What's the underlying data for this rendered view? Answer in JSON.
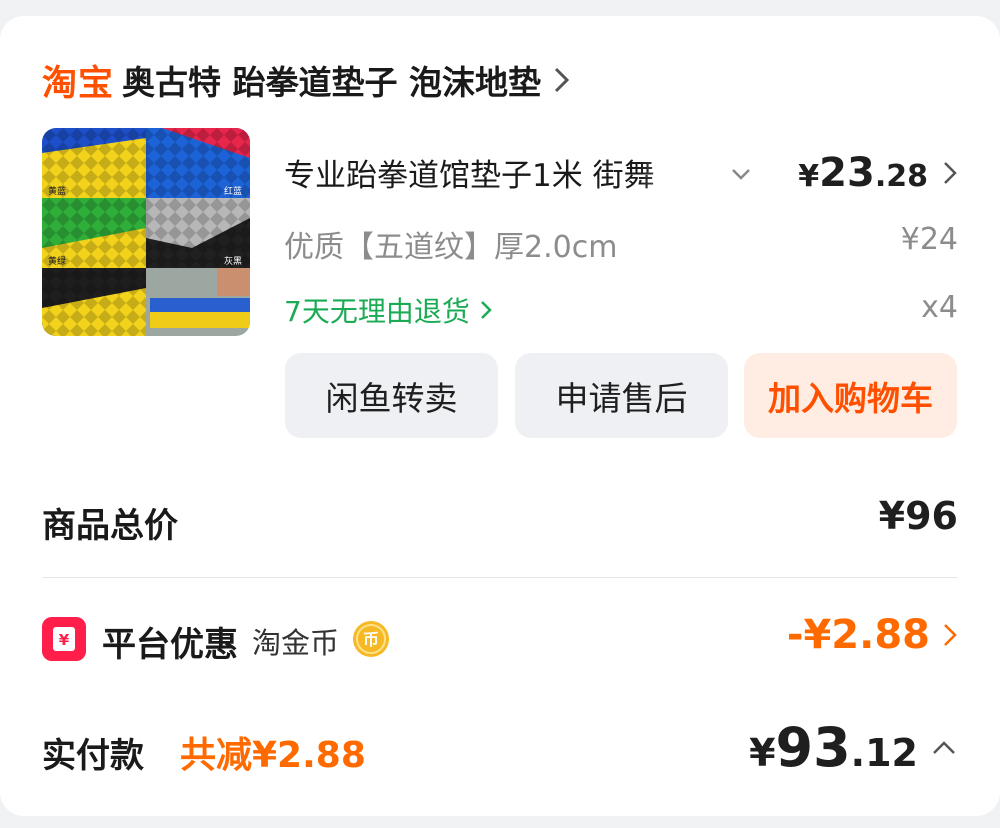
{
  "shop": {
    "logo": "淘宝",
    "name": "奥古特 跆拳道垫子 泡沫地垫"
  },
  "product": {
    "title": "专业跆拳道馆垫子1米 街舞",
    "spec": "优质【五道纹】厚2.0cm",
    "price_symbol": "¥",
    "price_int": "23",
    "price_dec": ".28",
    "original_price": "¥24",
    "return_policy": "7天无理由退货",
    "quantity": "x4",
    "thumb_labels": [
      "黄蓝",
      "红蓝",
      "黄绿",
      "灰黑"
    ]
  },
  "actions": {
    "xianyu": "闲鱼转卖",
    "after_sale": "申请售后",
    "add_cart": "加入购物车"
  },
  "totals": {
    "goods_total_label": "商品总价",
    "goods_total_value": "¥96",
    "promo_label": "平台优惠",
    "promo_sub": "淘金币",
    "promo_value": "-¥2.88",
    "pay_label": "实付款",
    "pay_reduce": "共减¥2.88",
    "pay_symbol": "¥",
    "pay_int": "93",
    "pay_dec": ".12"
  },
  "colors": {
    "brand": "#ff5000",
    "promo": "#ff6a00",
    "green": "#1bab54"
  }
}
